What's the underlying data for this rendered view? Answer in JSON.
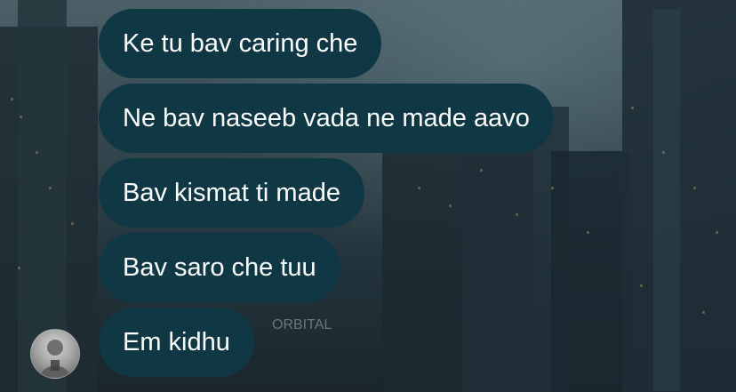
{
  "messages": [
    "Ke tu bav caring che",
    "Ne bav naseeb vada ne made aavo",
    "Bav kismat ti made",
    "Bav saro che tuu",
    "Em kidhu"
  ],
  "background_sign_text": "ORBITAL",
  "colors": {
    "bubble": "#0f3744",
    "text": "#ffffff"
  },
  "avatar": {
    "icon": "user-avatar"
  }
}
